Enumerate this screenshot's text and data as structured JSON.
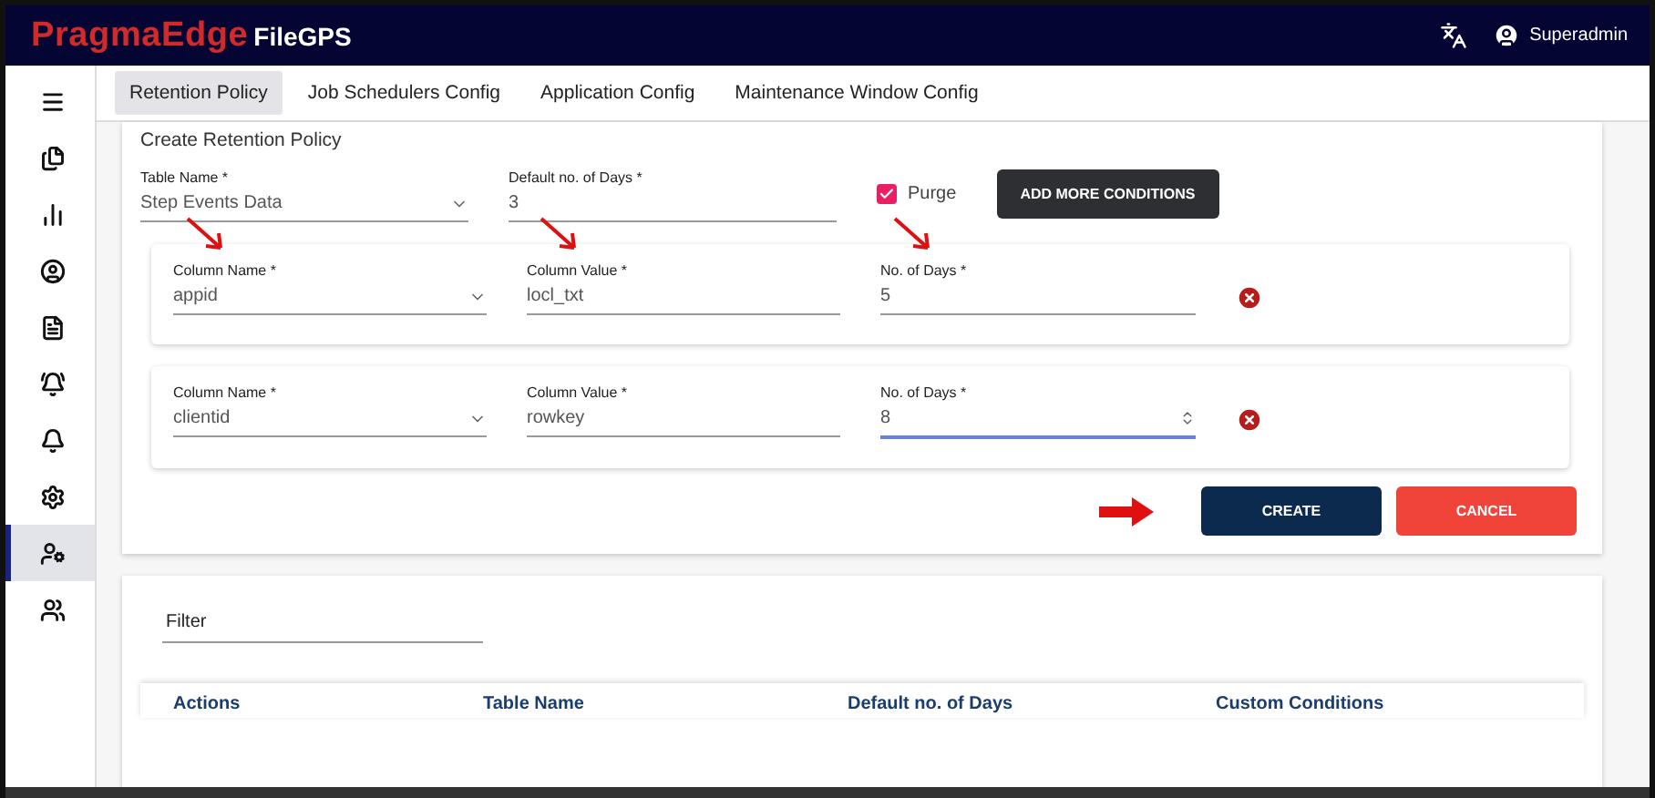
{
  "header": {
    "brand": "PragmaEdge",
    "product": "FileGPS",
    "user": "Superadmin"
  },
  "sidebar": {
    "items": [
      {
        "selected": false
      },
      {
        "selected": false
      },
      {
        "selected": false
      },
      {
        "selected": false
      },
      {
        "selected": false
      },
      {
        "selected": false
      },
      {
        "selected": false
      },
      {
        "selected": false
      },
      {
        "selected": true
      },
      {
        "selected": false
      }
    ]
  },
  "tabs": [
    {
      "label": "Retention Policy",
      "selected": true
    },
    {
      "label": "Job Schedulers Config",
      "selected": false
    },
    {
      "label": "Application Config",
      "selected": false
    },
    {
      "label": "Maintenance Window Config",
      "selected": false
    }
  ],
  "form": {
    "title": "Create Retention Policy",
    "fields": [
      {
        "label": "Table Name *",
        "value": "Step Events Data",
        "kind": "select"
      },
      {
        "label": "Default no. of Days *",
        "value": "3",
        "kind": "text"
      }
    ],
    "purge": {
      "label": "Purge",
      "checked": true
    },
    "add_button": "ADD MORE CONDITIONS",
    "conditions": [
      {
        "fields": [
          {
            "label": "Column Name *",
            "value": "appid",
            "kind": "select",
            "annotated": true,
            "focused": false
          },
          {
            "label": "Column Value *",
            "value": "locl_txt",
            "kind": "text",
            "annotated": true,
            "focused": false
          },
          {
            "label": "No. of Days *",
            "value": "5",
            "kind": "text",
            "annotated": true,
            "focused": false
          }
        ]
      },
      {
        "fields": [
          {
            "label": "Column Name *",
            "value": "clientid",
            "kind": "select",
            "annotated": false,
            "focused": false
          },
          {
            "label": "Column Value *",
            "value": "rowkey",
            "kind": "text",
            "annotated": false,
            "focused": false
          },
          {
            "label": "No. of Days *",
            "value": "8",
            "kind": "number",
            "annotated": false,
            "focused": true
          }
        ]
      }
    ],
    "create_button": {
      "label": "CREATE",
      "annotated": true
    },
    "cancel_button": "CANCEL"
  },
  "list": {
    "filter_label": "Filter",
    "columns": [
      "Actions",
      "Table Name",
      "Default no. of Days",
      "Custom Conditions"
    ]
  }
}
